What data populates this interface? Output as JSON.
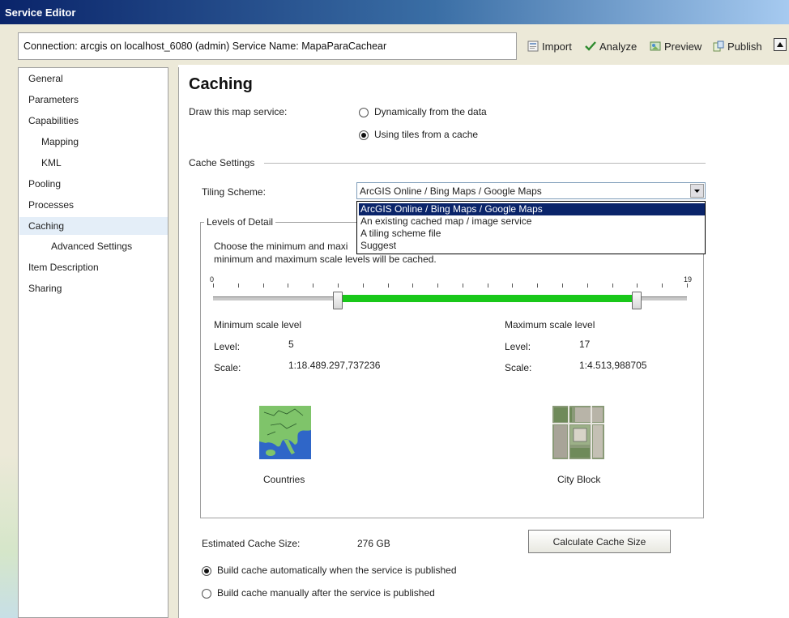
{
  "window": {
    "title": "Service Editor"
  },
  "toolbar": {
    "connection_text": "Connection: arcgis on localhost_6080 (admin)   Service Name: MapaParaCachear",
    "import_label": "Import",
    "analyze_label": "Analyze",
    "preview_label": "Preview",
    "publish_label": "Publish",
    "analyze_color": "#2e8b2e"
  },
  "sidebar": {
    "items": [
      {
        "label": "General"
      },
      {
        "label": "Parameters"
      },
      {
        "label": "Capabilities"
      },
      {
        "label": "Mapping"
      },
      {
        "label": "KML"
      },
      {
        "label": "Pooling"
      },
      {
        "label": "Processes"
      },
      {
        "label": "Caching"
      },
      {
        "label": "Advanced Settings"
      },
      {
        "label": "Item Description"
      },
      {
        "label": "Sharing"
      }
    ],
    "selected": "Caching"
  },
  "main": {
    "title": "Caching",
    "draw_label": "Draw this map service:",
    "draw_options": [
      {
        "label": "Dynamically from the data",
        "checked": false
      },
      {
        "label": "Using tiles from a cache",
        "checked": true
      }
    ],
    "cache_settings_label": "Cache Settings",
    "tiling_scheme_label": "Tiling Scheme:",
    "tiling_scheme_value": "ArcGIS Online / Bing Maps / Google Maps",
    "tiling_options": [
      "ArcGIS Online / Bing Maps / Google Maps",
      "An existing cached map / image service",
      "A tiling scheme file",
      "Suggest"
    ],
    "lod": {
      "legend": "Levels of Detail",
      "desc_line1": "Choose the minimum and maxi",
      "desc_line2": "minimum and maximum scale levels will be cached.",
      "slider_min_label": "0",
      "slider_max_label": "19",
      "slider_min": 0,
      "slider_max": 19,
      "selected_min": 5,
      "selected_max": 17,
      "min_heading": "Minimum scale level",
      "max_heading": "Maximum scale level",
      "level_label": "Level:",
      "scale_label": "Scale:",
      "min_level": "5",
      "max_level": "17",
      "min_scale": "1:18.489.297,737236",
      "max_scale": "1:4.513,988705",
      "min_caption": "Countries",
      "max_caption": "City Block",
      "range_color": "#19c81a"
    },
    "estimated_label": "Estimated Cache Size:",
    "estimated_value": "276 GB",
    "calc_button": "Calculate Cache Size",
    "build_options": [
      {
        "label": "Build cache automatically when the service is published",
        "checked": true
      },
      {
        "label": "Build cache manually after the service is published",
        "checked": false
      }
    ]
  }
}
